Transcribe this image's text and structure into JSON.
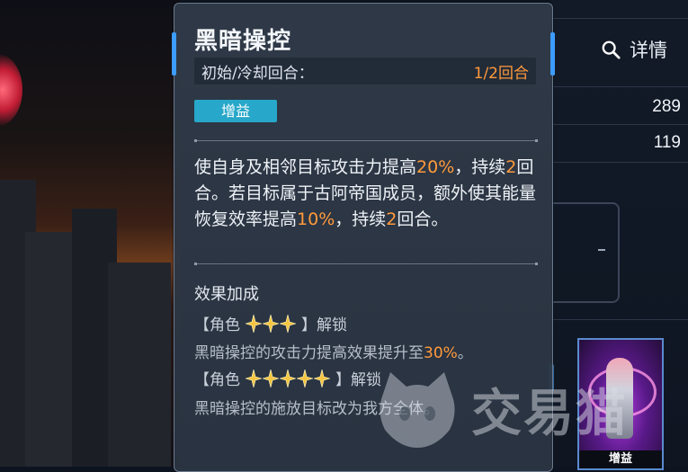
{
  "skill": {
    "name": "黑暗操控",
    "cooldown_label": "初始/冷却回合：",
    "cooldown_value": "1/2回合",
    "type_badge": "增益",
    "description": {
      "p1": "使自身及相邻目标攻击力提高",
      "v1": "20%",
      "p2": "，持续",
      "v2": "2",
      "p3": "回合。若目标属于古阿帝国成员，额外使其能量恢复效率提高",
      "v3": "10%",
      "p4": "，持续",
      "v4": "2",
      "p5": "回合。"
    },
    "bonus_title": "效果加成",
    "bonuses": [
      {
        "prefix": "【角色",
        "stars": 3,
        "suffix": "】解锁",
        "detail": "黑暗操控的攻击力提高效果提升至",
        "detail_value": "30%",
        "detail_end": "。"
      },
      {
        "prefix": "【角色",
        "stars": 5,
        "suffix": "】解锁",
        "detail": "黑暗操控的施放目标改为我方全体。"
      }
    ]
  },
  "right_panel": {
    "details_label": "详情",
    "stat_1": "289",
    "stat_2": "119",
    "card_tag": "增益"
  },
  "watermark": {
    "text": "交易猫"
  },
  "colors": {
    "highlight": "#ff9a3c",
    "badge": "#27a7c9",
    "accent": "#3d9cff",
    "star": "#f4c542"
  }
}
